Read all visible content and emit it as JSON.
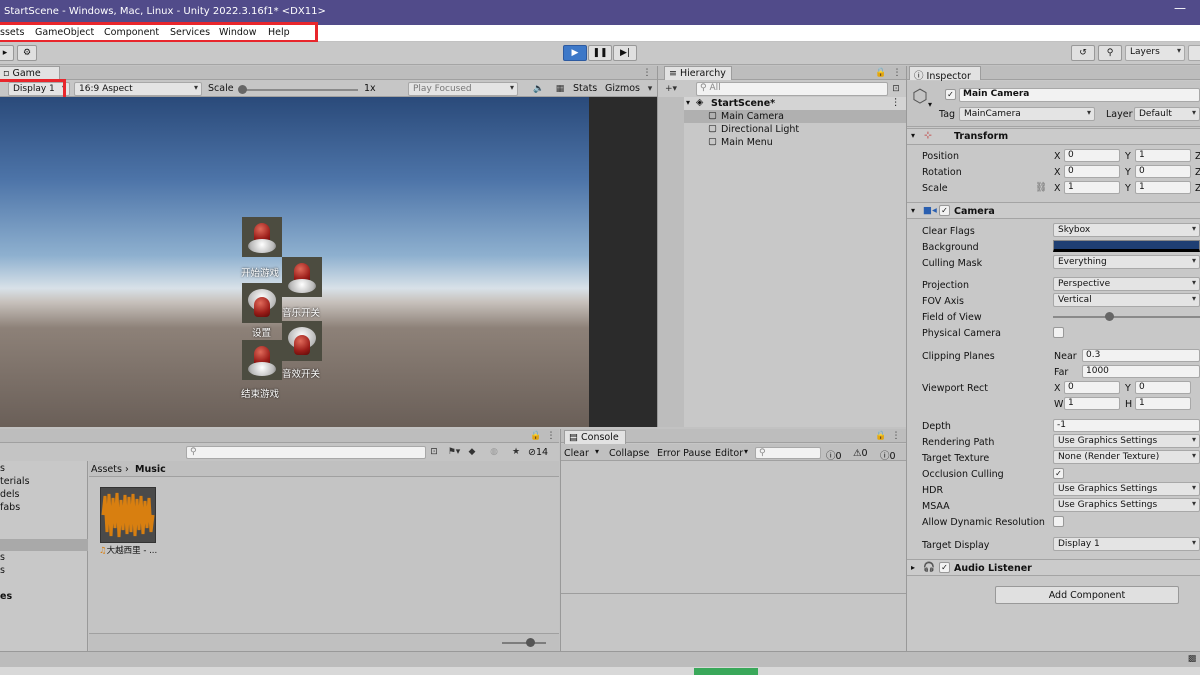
{
  "window": {
    "title": "StartScene - Windows, Mac, Linux - Unity 2022.3.16f1* <DX11>",
    "minimize_glyph": "—"
  },
  "menu": [
    "ssets",
    "GameObject",
    "Component",
    "Services",
    "Window",
    "Help"
  ],
  "toolbar": {
    "layers": "Layers"
  },
  "game": {
    "tab_label": "Game",
    "display": "Display 1",
    "aspect": "16:9 Aspect",
    "scale_label": "Scale",
    "scale_value": "1x",
    "play_mode": "Play Focused",
    "stats": "Stats",
    "gizmos": "Gizmos",
    "buttons": [
      "开始游戏",
      "音乐开关",
      "设置",
      "音效开关",
      "结束游戏"
    ]
  },
  "hierarchy": {
    "tab_label": "Hierarchy",
    "search_placeholder": "All",
    "scene": "StartScene*",
    "items": [
      "Main Camera",
      "Directional Light",
      "Main Menu"
    ]
  },
  "project": {
    "count": "14",
    "tree_items": [
      "s",
      "terials",
      "dels",
      "fabs",
      "s",
      "s",
      "es"
    ],
    "breadcrumb_root": "Assets",
    "breadcrumb_current": "Music",
    "asset_name": "大越西里 - ..."
  },
  "console": {
    "tab_label": "Console",
    "clear": "Clear",
    "collapse": "Collapse",
    "error_pause": "Error Pause",
    "editor": "Editor",
    "count_errors": "0",
    "count_warnings": "0",
    "count_logs": "0"
  },
  "inspector": {
    "tab_label": "Inspector",
    "object_name": "Main Camera",
    "tag_label": "Tag",
    "tag": "MainCamera",
    "layer_label": "Layer",
    "layer": "Default",
    "transform": {
      "title": "Transform",
      "position_label": "Position",
      "position": {
        "x": "0",
        "y": "1"
      },
      "rotation_label": "Rotation",
      "rotation": {
        "x": "0",
        "y": "0"
      },
      "scale_label": "Scale",
      "scale": {
        "x": "1",
        "y": "1"
      },
      "axis_x": "X",
      "axis_y": "Y",
      "axis_z": "Z"
    },
    "camera": {
      "title": "Camera",
      "clear_flags_label": "Clear Flags",
      "clear_flags": "Skybox",
      "background_label": "Background",
      "background_color": "#1f3f73",
      "culling_mask_label": "Culling Mask",
      "culling_mask": "Everything",
      "projection_label": "Projection",
      "projection": "Perspective",
      "fov_axis_label": "FOV Axis",
      "fov_axis": "Vertical",
      "fov_label": "Field of View",
      "physical_camera_label": "Physical Camera",
      "clipping_label": "Clipping Planes",
      "near_label": "Near",
      "near": "0.3",
      "far_label": "Far",
      "far": "1000",
      "viewport_label": "Viewport Rect",
      "vp_x_label": "X",
      "vp_x": "0",
      "vp_y_label": "Y",
      "vp_y": "0",
      "vp_w_label": "W",
      "vp_w": "1",
      "vp_h_label": "H",
      "vp_h": "1",
      "depth_label": "Depth",
      "depth": "-1",
      "rendering_path_label": "Rendering Path",
      "rendering_path": "Use Graphics Settings",
      "target_texture_label": "Target Texture",
      "target_texture": "None (Render Texture)",
      "occlusion_label": "Occlusion Culling",
      "hdr_label": "HDR",
      "hdr": "Use Graphics Settings",
      "msaa_label": "MSAA",
      "msaa": "Use Graphics Settings",
      "dynamic_res_label": "Allow Dynamic Resolution",
      "target_display_label": "Target Display",
      "target_display": "Display 1"
    },
    "audio_listener": "Audio Listener",
    "add_component": "Add Component"
  },
  "colors": {
    "title_bar": "#514b8a",
    "highlight_box": "#e8262c",
    "play_button": "#3d78c8",
    "audio_waveform": "#d87f10"
  }
}
